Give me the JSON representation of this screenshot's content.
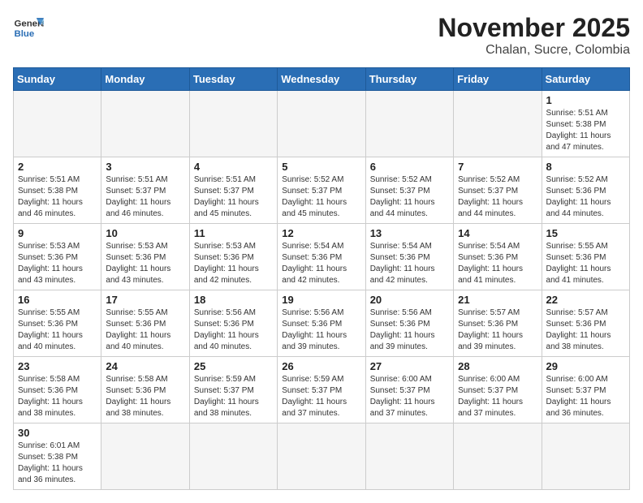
{
  "header": {
    "logo_general": "General",
    "logo_blue": "Blue",
    "month_year": "November 2025",
    "location": "Chalan, Sucre, Colombia"
  },
  "weekdays": [
    "Sunday",
    "Monday",
    "Tuesday",
    "Wednesday",
    "Thursday",
    "Friday",
    "Saturday"
  ],
  "days": {
    "1": {
      "sunrise": "5:51 AM",
      "sunset": "5:38 PM",
      "daylight": "11 hours and 47 minutes."
    },
    "2": {
      "sunrise": "5:51 AM",
      "sunset": "5:38 PM",
      "daylight": "11 hours and 46 minutes."
    },
    "3": {
      "sunrise": "5:51 AM",
      "sunset": "5:37 PM",
      "daylight": "11 hours and 46 minutes."
    },
    "4": {
      "sunrise": "5:51 AM",
      "sunset": "5:37 PM",
      "daylight": "11 hours and 45 minutes."
    },
    "5": {
      "sunrise": "5:52 AM",
      "sunset": "5:37 PM",
      "daylight": "11 hours and 45 minutes."
    },
    "6": {
      "sunrise": "5:52 AM",
      "sunset": "5:37 PM",
      "daylight": "11 hours and 44 minutes."
    },
    "7": {
      "sunrise": "5:52 AM",
      "sunset": "5:37 PM",
      "daylight": "11 hours and 44 minutes."
    },
    "8": {
      "sunrise": "5:52 AM",
      "sunset": "5:36 PM",
      "daylight": "11 hours and 44 minutes."
    },
    "9": {
      "sunrise": "5:53 AM",
      "sunset": "5:36 PM",
      "daylight": "11 hours and 43 minutes."
    },
    "10": {
      "sunrise": "5:53 AM",
      "sunset": "5:36 PM",
      "daylight": "11 hours and 43 minutes."
    },
    "11": {
      "sunrise": "5:53 AM",
      "sunset": "5:36 PM",
      "daylight": "11 hours and 42 minutes."
    },
    "12": {
      "sunrise": "5:54 AM",
      "sunset": "5:36 PM",
      "daylight": "11 hours and 42 minutes."
    },
    "13": {
      "sunrise": "5:54 AM",
      "sunset": "5:36 PM",
      "daylight": "11 hours and 42 minutes."
    },
    "14": {
      "sunrise": "5:54 AM",
      "sunset": "5:36 PM",
      "daylight": "11 hours and 41 minutes."
    },
    "15": {
      "sunrise": "5:55 AM",
      "sunset": "5:36 PM",
      "daylight": "11 hours and 41 minutes."
    },
    "16": {
      "sunrise": "5:55 AM",
      "sunset": "5:36 PM",
      "daylight": "11 hours and 40 minutes."
    },
    "17": {
      "sunrise": "5:55 AM",
      "sunset": "5:36 PM",
      "daylight": "11 hours and 40 minutes."
    },
    "18": {
      "sunrise": "5:56 AM",
      "sunset": "5:36 PM",
      "daylight": "11 hours and 40 minutes."
    },
    "19": {
      "sunrise": "5:56 AM",
      "sunset": "5:36 PM",
      "daylight": "11 hours and 39 minutes."
    },
    "20": {
      "sunrise": "5:56 AM",
      "sunset": "5:36 PM",
      "daylight": "11 hours and 39 minutes."
    },
    "21": {
      "sunrise": "5:57 AM",
      "sunset": "5:36 PM",
      "daylight": "11 hours and 39 minutes."
    },
    "22": {
      "sunrise": "5:57 AM",
      "sunset": "5:36 PM",
      "daylight": "11 hours and 38 minutes."
    },
    "23": {
      "sunrise": "5:58 AM",
      "sunset": "5:36 PM",
      "daylight": "11 hours and 38 minutes."
    },
    "24": {
      "sunrise": "5:58 AM",
      "sunset": "5:36 PM",
      "daylight": "11 hours and 38 minutes."
    },
    "25": {
      "sunrise": "5:59 AM",
      "sunset": "5:37 PM",
      "daylight": "11 hours and 38 minutes."
    },
    "26": {
      "sunrise": "5:59 AM",
      "sunset": "5:37 PM",
      "daylight": "11 hours and 37 minutes."
    },
    "27": {
      "sunrise": "6:00 AM",
      "sunset": "5:37 PM",
      "daylight": "11 hours and 37 minutes."
    },
    "28": {
      "sunrise": "6:00 AM",
      "sunset": "5:37 PM",
      "daylight": "11 hours and 37 minutes."
    },
    "29": {
      "sunrise": "6:00 AM",
      "sunset": "5:37 PM",
      "daylight": "11 hours and 36 minutes."
    },
    "30": {
      "sunrise": "6:01 AM",
      "sunset": "5:38 PM",
      "daylight": "11 hours and 36 minutes."
    }
  }
}
